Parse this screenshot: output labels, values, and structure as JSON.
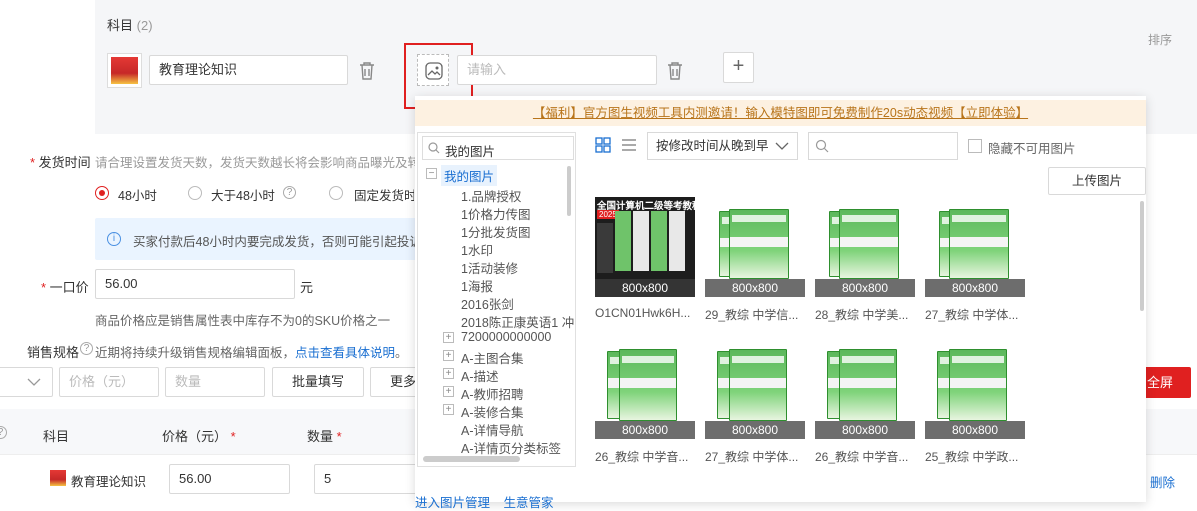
{
  "subjects": {
    "title": "科目",
    "count": "(2)",
    "sort_label": "排序",
    "item1_value": "教育理论知识",
    "item2_placeholder": "请输入"
  },
  "shipping": {
    "label": "发货时间",
    "hint": "请合理设置发货天数，发货天数越长将会影响商品曝光及转化",
    "options": [
      "48小时",
      "大于48小时",
      "固定发货时间"
    ],
    "notice": "买家付款后48小时内要完成发货，否则可能引起投诉与"
  },
  "price": {
    "label": "一口价",
    "value": "56.00",
    "unit": "元",
    "hint": "商品价格应是销售属性表中库存不为0的SKU价格之一"
  },
  "sales_spec": {
    "label": "销售规格",
    "hint": "近期将持续升级销售规格编辑面板，",
    "link": "点击查看具体说明",
    "dot": "。",
    "price_placeholder": "价格（元）",
    "qty_placeholder": "数量",
    "batch_btn": "批量填写",
    "more_btn": "更多",
    "fullscreen_btn": "全屏"
  },
  "table": {
    "col_subject": "科目",
    "col_price": "价格（元）",
    "col_qty": "数量",
    "row_subject": "教育理论知识",
    "row_price": "56.00",
    "row_qty": "5",
    "delete": "删除"
  },
  "picker": {
    "banner": "【福利】官方图生视频工具内测邀请！输入模特图即可免费制作20s动态视频【立即体验】",
    "search_placeholder": "我的图片",
    "sort_select": "按修改时间从晚到早",
    "hide_unavailable": "隐藏不可用图片",
    "upload_btn": "上传图片",
    "tree_root": "我的图片",
    "tree_items": [
      "1.品牌授权",
      "1价格力传图",
      "1分批发货图",
      "1水印",
      "1活动装修",
      "1海报",
      "2016张剑",
      "2018陈正康英语1 冲",
      "7200000000000",
      "A-主图合集",
      "A-描述",
      "A-教师招聘",
      "A-装修合集",
      "A-详情导航",
      "A-详情页分类标签"
    ],
    "images": [
      {
        "caption": "O1CN01Hwk6H...",
        "dim": "800x800",
        "badge": "全国计算机二级等考教程",
        "year": "2025"
      },
      {
        "caption": "29_教综 中学信...",
        "dim": "800x800"
      },
      {
        "caption": "28_教综 中学美...",
        "dim": "800x800"
      },
      {
        "caption": "27_教综 中学体...",
        "dim": "800x800"
      },
      {
        "caption": "26_教综 中学音...",
        "dim": "800x800"
      },
      {
        "caption": "27_教综 中学体...",
        "dim": "800x800"
      },
      {
        "caption": "26_教综 中学音...",
        "dim": "800x800"
      },
      {
        "caption": "25_教综 中学政...",
        "dim": "800x800"
      }
    ],
    "footer_link1": "进入图片管理",
    "footer_link2": "生意管家"
  },
  "colors": {
    "accent": "#e02020",
    "link": "#1a6fd1",
    "banner_text": "#b8741a"
  }
}
